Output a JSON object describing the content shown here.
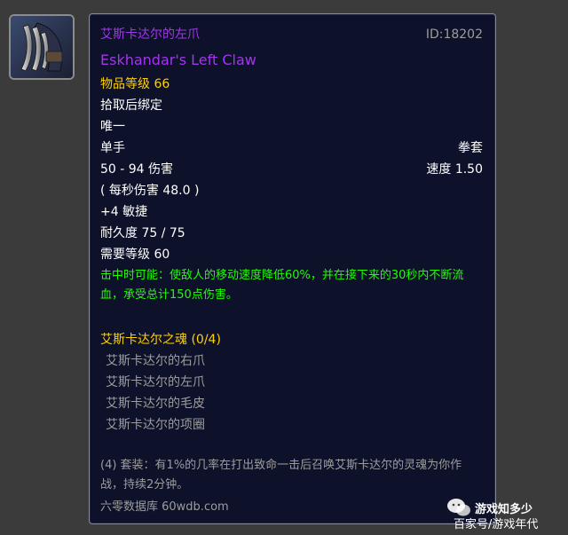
{
  "item": {
    "name_cn": "艾斯卡达尔的左爪",
    "id_label": "ID:18202",
    "name_en": "Eskhandar's Left Claw",
    "item_level": "物品等级 66",
    "bind": "拾取后绑定",
    "unique": "唯一",
    "slot": "单手",
    "type": "拳套",
    "damage": "50 - 94 伤害",
    "speed": "速度 1.50",
    "dps": "( 每秒伤害 48.0 )",
    "stat": "+4 敏捷",
    "durability": "耐久度 75 / 75",
    "required_level": "需要等级 60",
    "effect": "击中时可能：使敌人的移动速度降低60%，并在接下来的30秒内不断流血，承受总计150点伤害。",
    "set_name": "艾斯卡达尔之魂 (0/4)",
    "set_pieces": [
      "艾斯卡达尔的右爪",
      "艾斯卡达尔的左爪",
      "艾斯卡达尔的毛皮",
      "艾斯卡达尔的项圈"
    ],
    "set_bonus": "(4) 套装：有1%的几率在打出致命一击后召唤艾斯卡达尔的灵魂为你作战，持续2分钟。",
    "source": "六零数据库 60wdb.com"
  },
  "icon": "claw-weapon-icon",
  "colors": {
    "epic": "#a335ee",
    "item_level": "#ffd100",
    "effect": "#1eff00",
    "set_inactive": "#9d9d9d",
    "tooltip_bg": "#0d1129"
  },
  "watermark": {
    "line1": "游戏知多少",
    "line2": "百家号/游戏年代"
  }
}
